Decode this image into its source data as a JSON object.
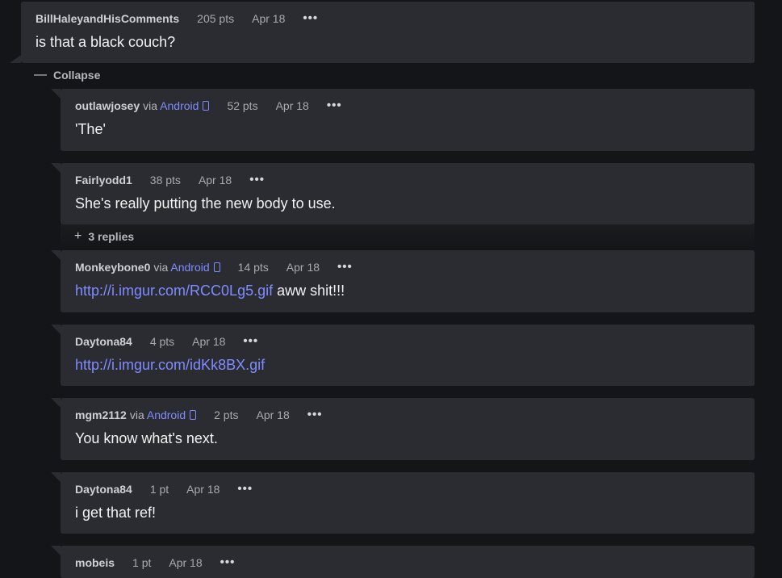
{
  "parent": {
    "author": "BillHaleyandHisComments",
    "points": "205 pts",
    "date": "Apr 18",
    "more": "•••",
    "body": "is that a black couch?"
  },
  "collapse_label": "Collapse",
  "collapse_symbol": "—",
  "replies_toggle": {
    "symbol": "+",
    "label": "3 replies"
  },
  "comments": [
    {
      "author": "outlawjosey",
      "via": "via",
      "platform": "Android",
      "points": "52 pts",
      "date": "Apr 18",
      "more": "•••",
      "body": "'The'"
    },
    {
      "author": "Fairlyodd1",
      "points": "38 pts",
      "date": "Apr 18",
      "more": "•••",
      "body": "She's really putting the new body to use."
    },
    {
      "author": "Monkeybone0",
      "via": "via",
      "platform": "Android",
      "points": "14 pts",
      "date": "Apr 18",
      "more": "•••",
      "link": "http://i.imgur.com/RCC0Lg5.gif",
      "body_after": " aww shit!!!"
    },
    {
      "author": "Daytona84",
      "points": "4 pts",
      "date": "Apr 18",
      "more": "•••",
      "link": "http://i.imgur.com/idKk8BX.gif"
    },
    {
      "author": "mgm2112",
      "via": "via",
      "platform": "Android",
      "points": "2 pts",
      "date": "Apr 18",
      "more": "•••",
      "body": "You know what's next."
    },
    {
      "author": "Daytona84",
      "points": "1 pt",
      "date": "Apr 18",
      "more": "•••",
      "body": "i get that ref!"
    },
    {
      "author": "mobeis",
      "points": "1 pt",
      "date": "Apr 18",
      "more": "•••"
    }
  ],
  "colors": {
    "background": "#141518",
    "card": "#2b2c31",
    "link": "#7f8cff"
  }
}
